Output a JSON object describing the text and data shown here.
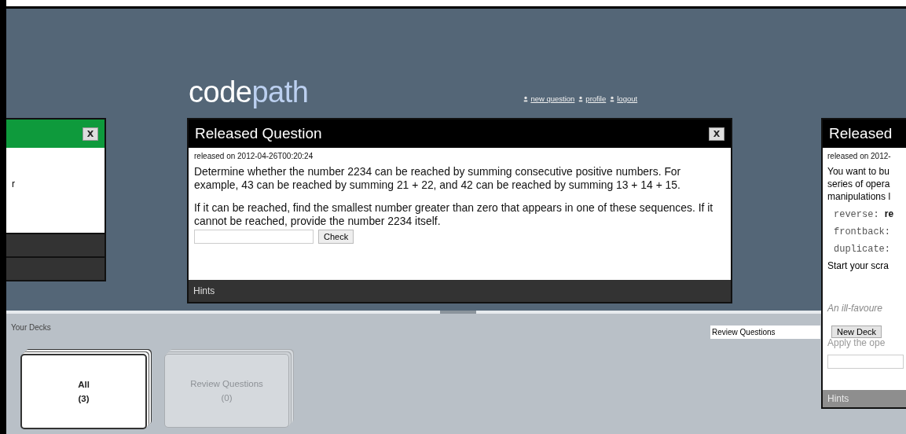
{
  "header": {
    "logo": {
      "first": "code",
      "second": "path"
    },
    "nav": [
      {
        "label": "new question"
      },
      {
        "label": "profile"
      },
      {
        "label": "logout"
      }
    ]
  },
  "cards": [
    {
      "kind": "left",
      "color": "#0e9a3c",
      "close": "X",
      "lines": [
        "r"
      ]
    },
    {
      "kind": "center",
      "color": "#000000",
      "title": "Released Question",
      "close": "X",
      "released": "released on 2012-04-26T00:20:24",
      "paragraphs": [
        "Determine whether the number 2234 can be reached by summing consecutive positive numbers. For example, 43 can be reached by summing 21 + 22, and 42 can be reached by summing 13 + 14 + 15.",
        "If it can be reached, find the smallest number greater than zero that appears in one of these sequences. If it cannot be reached, provide the number 2234 itself."
      ],
      "button": "Check",
      "hints": "Hints"
    },
    {
      "kind": "right",
      "color": "#000000",
      "title": "Released",
      "released": "released on 2012-",
      "lines": [
        "You want to bu",
        "series of opera",
        "manipulations l"
      ],
      "code": [
        {
          "code": "reverse:",
          "text": "re"
        },
        {
          "code": "frontback:"
        },
        {
          "code": "duplicate:"
        }
      ],
      "after": "Start your scra",
      "example": "An ill-favoure",
      "apply": "Apply the ope",
      "hints": "Hints"
    }
  ],
  "decks_panel": {
    "title": "Your Decks",
    "decks": [
      {
        "name": "All",
        "count": "(3)",
        "selected": true
      },
      {
        "name": "Review Questions",
        "count": "(0)",
        "selected": false
      }
    ],
    "new_deck": {
      "value": "Review Questions",
      "button": "New Deck"
    }
  }
}
